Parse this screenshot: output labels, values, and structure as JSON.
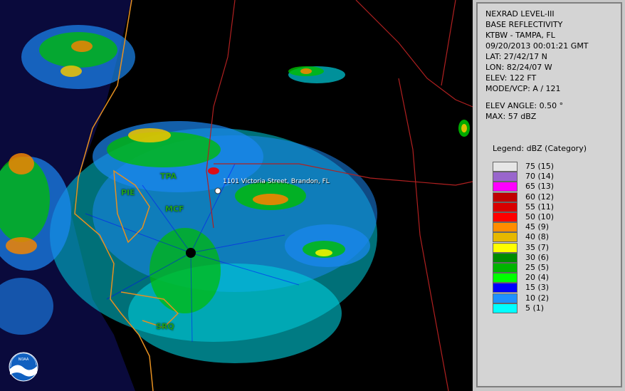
{
  "info": {
    "product": "NEXRAD LEVEL-III",
    "type": "BASE REFLECTIVITY",
    "station": "KTBW - TAMPA, FL",
    "datetime": "09/20/2013 00:01:21 GMT",
    "lat": "LAT: 27/42/17 N",
    "lon": "LON: 82/24/07 W",
    "elev": "ELEV: 122 FT",
    "mode": "MODE/VCP: A / 121",
    "elev_angle": "ELEV ANGLE: 0.50 °",
    "max": "MAX: 57 dBZ"
  },
  "legend": {
    "title": "Legend: dBZ (Category)",
    "items": [
      {
        "label": "75  (15)",
        "color": "#e6e6e6"
      },
      {
        "label": "70  (14)",
        "color": "#9966cc"
      },
      {
        "label": "65  (13)",
        "color": "#ff00ff"
      },
      {
        "label": "60  (12)",
        "color": "#c00000"
      },
      {
        "label": "55  (11)",
        "color": "#d80000"
      },
      {
        "label": "50  (10)",
        "color": "#ff0000"
      },
      {
        "label": "45  (9)",
        "color": "#ff8c00"
      },
      {
        "label": "40  (8)",
        "color": "#e6b800"
      },
      {
        "label": "35  (7)",
        "color": "#ffff00"
      },
      {
        "label": "30  (6)",
        "color": "#008c00"
      },
      {
        "label": "25  (5)",
        "color": "#00b400"
      },
      {
        "label": "20  (4)",
        "color": "#00ff00"
      },
      {
        "label": "15  (3)",
        "color": "#0000ff"
      },
      {
        "label": "10  (2)",
        "color": "#1e90ff"
      },
      {
        "label": "5  (1)",
        "color": "#00ffff"
      }
    ]
  },
  "map": {
    "address": "1101 Victoria Street, Brandon, FL",
    "labels": [
      "TPA",
      "PIE",
      "MCF",
      "SRQ"
    ],
    "logo": "NOAA"
  }
}
